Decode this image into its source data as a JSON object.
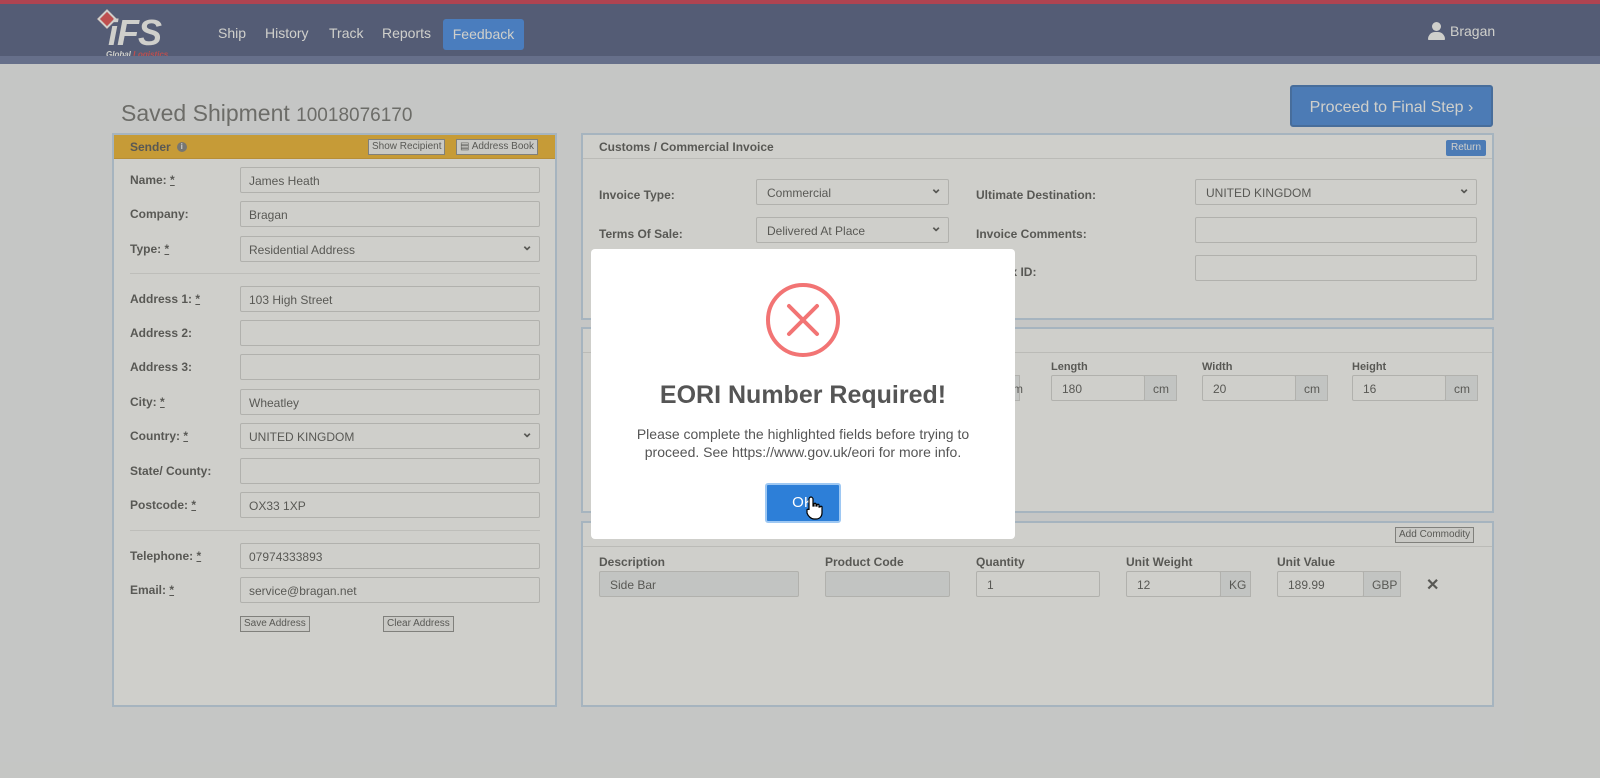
{
  "nav": {
    "logo_text": "iFS",
    "logo_sub_a": "Global",
    "logo_sub_b": "Logistics",
    "items": [
      "Ship",
      "History",
      "Track",
      "Reports"
    ],
    "feedback": "Feedback",
    "user": "Bragan"
  },
  "page": {
    "title": "Saved Shipment",
    "shipment_number": "10018076170",
    "proceed_button": "Proceed to Final Step ›"
  },
  "sender": {
    "heading": "Sender",
    "info_icon": "i",
    "show_recipient": "Show Recipient",
    "address_book": "Address Book",
    "fields": {
      "name_label": "Name:",
      "name": "James Heath",
      "company_label": "Company:",
      "company": "Bragan",
      "type_label": "Type:",
      "type": "Residential Address",
      "address1_label": "Address 1:",
      "address1": "103 High Street",
      "address2_label": "Address 2:",
      "address2": "",
      "address3_label": "Address 3:",
      "address3": "",
      "city_label": "City:",
      "city": "Wheatley",
      "country_label": "Country:",
      "country": "UNITED KINGDOM",
      "state_label": "State/ County:",
      "state": "",
      "postcode_label": "Postcode:",
      "postcode": "OX33 1XP",
      "telephone_label": "Telephone:",
      "telephone": "07974333893",
      "email_label": "Email:",
      "email": "service@bragan.net"
    },
    "required_mark": "*",
    "save_address": "Save Address",
    "clear_address": "Clear Address"
  },
  "customs": {
    "heading": "Customs / Commercial Invoice",
    "return": "Return",
    "invoice_type_label": "Invoice Type:",
    "invoice_type": "Commercial",
    "terms_label": "Terms Of Sale:",
    "terms": "Delivered At Place",
    "ultimate_dest_label": "Ultimate Destination:",
    "ultimate_dest": "UNITED KINGDOM",
    "invoice_comments_label": "Invoice Comments:",
    "invoice_comments": "",
    "tax_id_label": "ent Tax ID:",
    "tax_id": ""
  },
  "package": {
    "length_label": "Length",
    "length": "180",
    "length_unit": "cm",
    "width_label": "Width",
    "width": "20",
    "width_unit": "cm",
    "height_label": "Height",
    "height": "16",
    "height_unit": "cm",
    "hidden_unit": "cm"
  },
  "commodity": {
    "add_commodity": "Add Commodity",
    "description_label": "Description",
    "description": "Side Bar",
    "product_code_label": "Product Code",
    "product_code": "",
    "quantity_label": "Quantity",
    "quantity": "1",
    "unit_weight_label": "Unit Weight",
    "unit_weight": "12",
    "weight_unit": "KG",
    "unit_value_label": "Unit Value",
    "unit_value": "189.99",
    "currency": "GBP",
    "remove": "✕"
  },
  "modal": {
    "title": "EORI Number Required!",
    "message": "Please complete the highlighted fields before trying to proceed. See https://www.gov.uk/eori for more info.",
    "ok": "OK"
  },
  "colors": {
    "nav": "#2c3a6b",
    "accent": "#1e6fd9",
    "sender_header": "#f0a500",
    "error": "#f27474"
  }
}
